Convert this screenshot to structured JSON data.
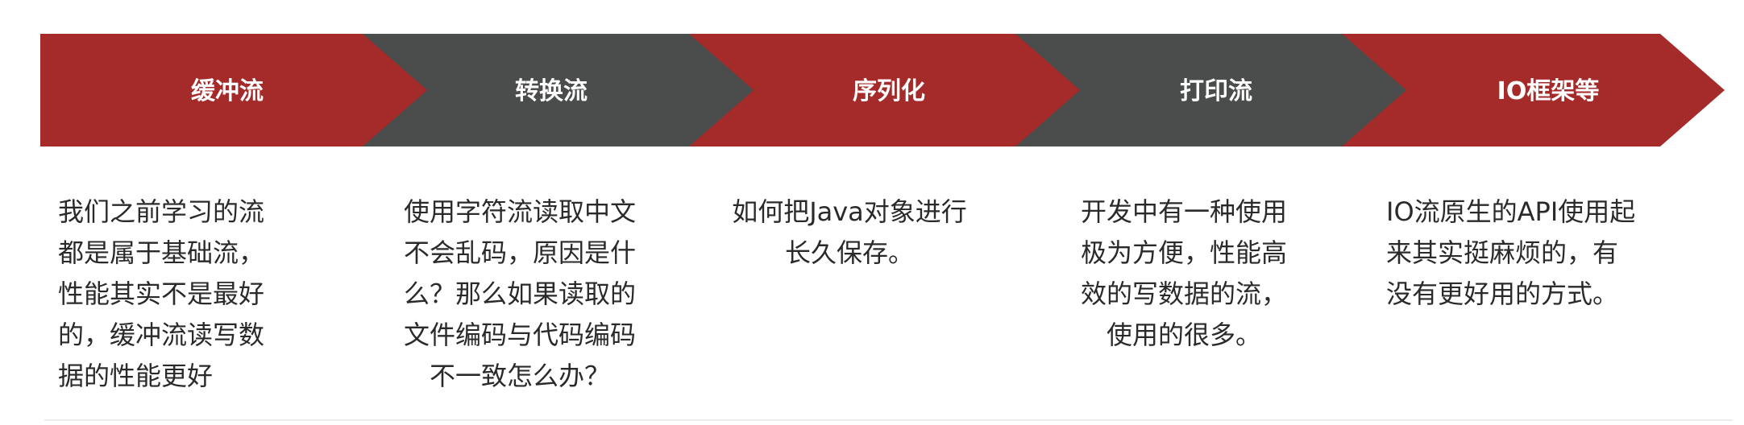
{
  "colors": {
    "red": "#a52a2a",
    "gray": "#4a4d4c"
  },
  "steps": [
    {
      "label": "缓冲流",
      "color": "red",
      "desc": [
        "我们之前学习的流",
        "都是属于基础流，",
        "性能其实不是最好",
        "的，缓冲流读写数",
        "据的性能更好"
      ],
      "align": "left"
    },
    {
      "label": "转换流",
      "color": "gray",
      "desc": [
        "使用字符流读取中文",
        "不会乱码，原因是什",
        "么？那么如果读取的",
        "文件编码与代码编码",
        "不一致怎么办？"
      ],
      "align": "center"
    },
    {
      "label": "序列化",
      "color": "red",
      "desc": [
        "如何把Java对象进行",
        "长久保存。"
      ],
      "align": "center"
    },
    {
      "label": "打印流",
      "color": "gray",
      "desc": [
        "开发中有一种使用",
        "极为方便，性能高",
        "效的写数据的流，",
        "使用的很多。"
      ],
      "align": "center"
    },
    {
      "label": "IO框架等",
      "color": "red",
      "desc": [
        "IO流原生的API使用起",
        "来其实挺麻烦的，有",
        "没有更好用的方式。"
      ],
      "align": "left"
    }
  ]
}
